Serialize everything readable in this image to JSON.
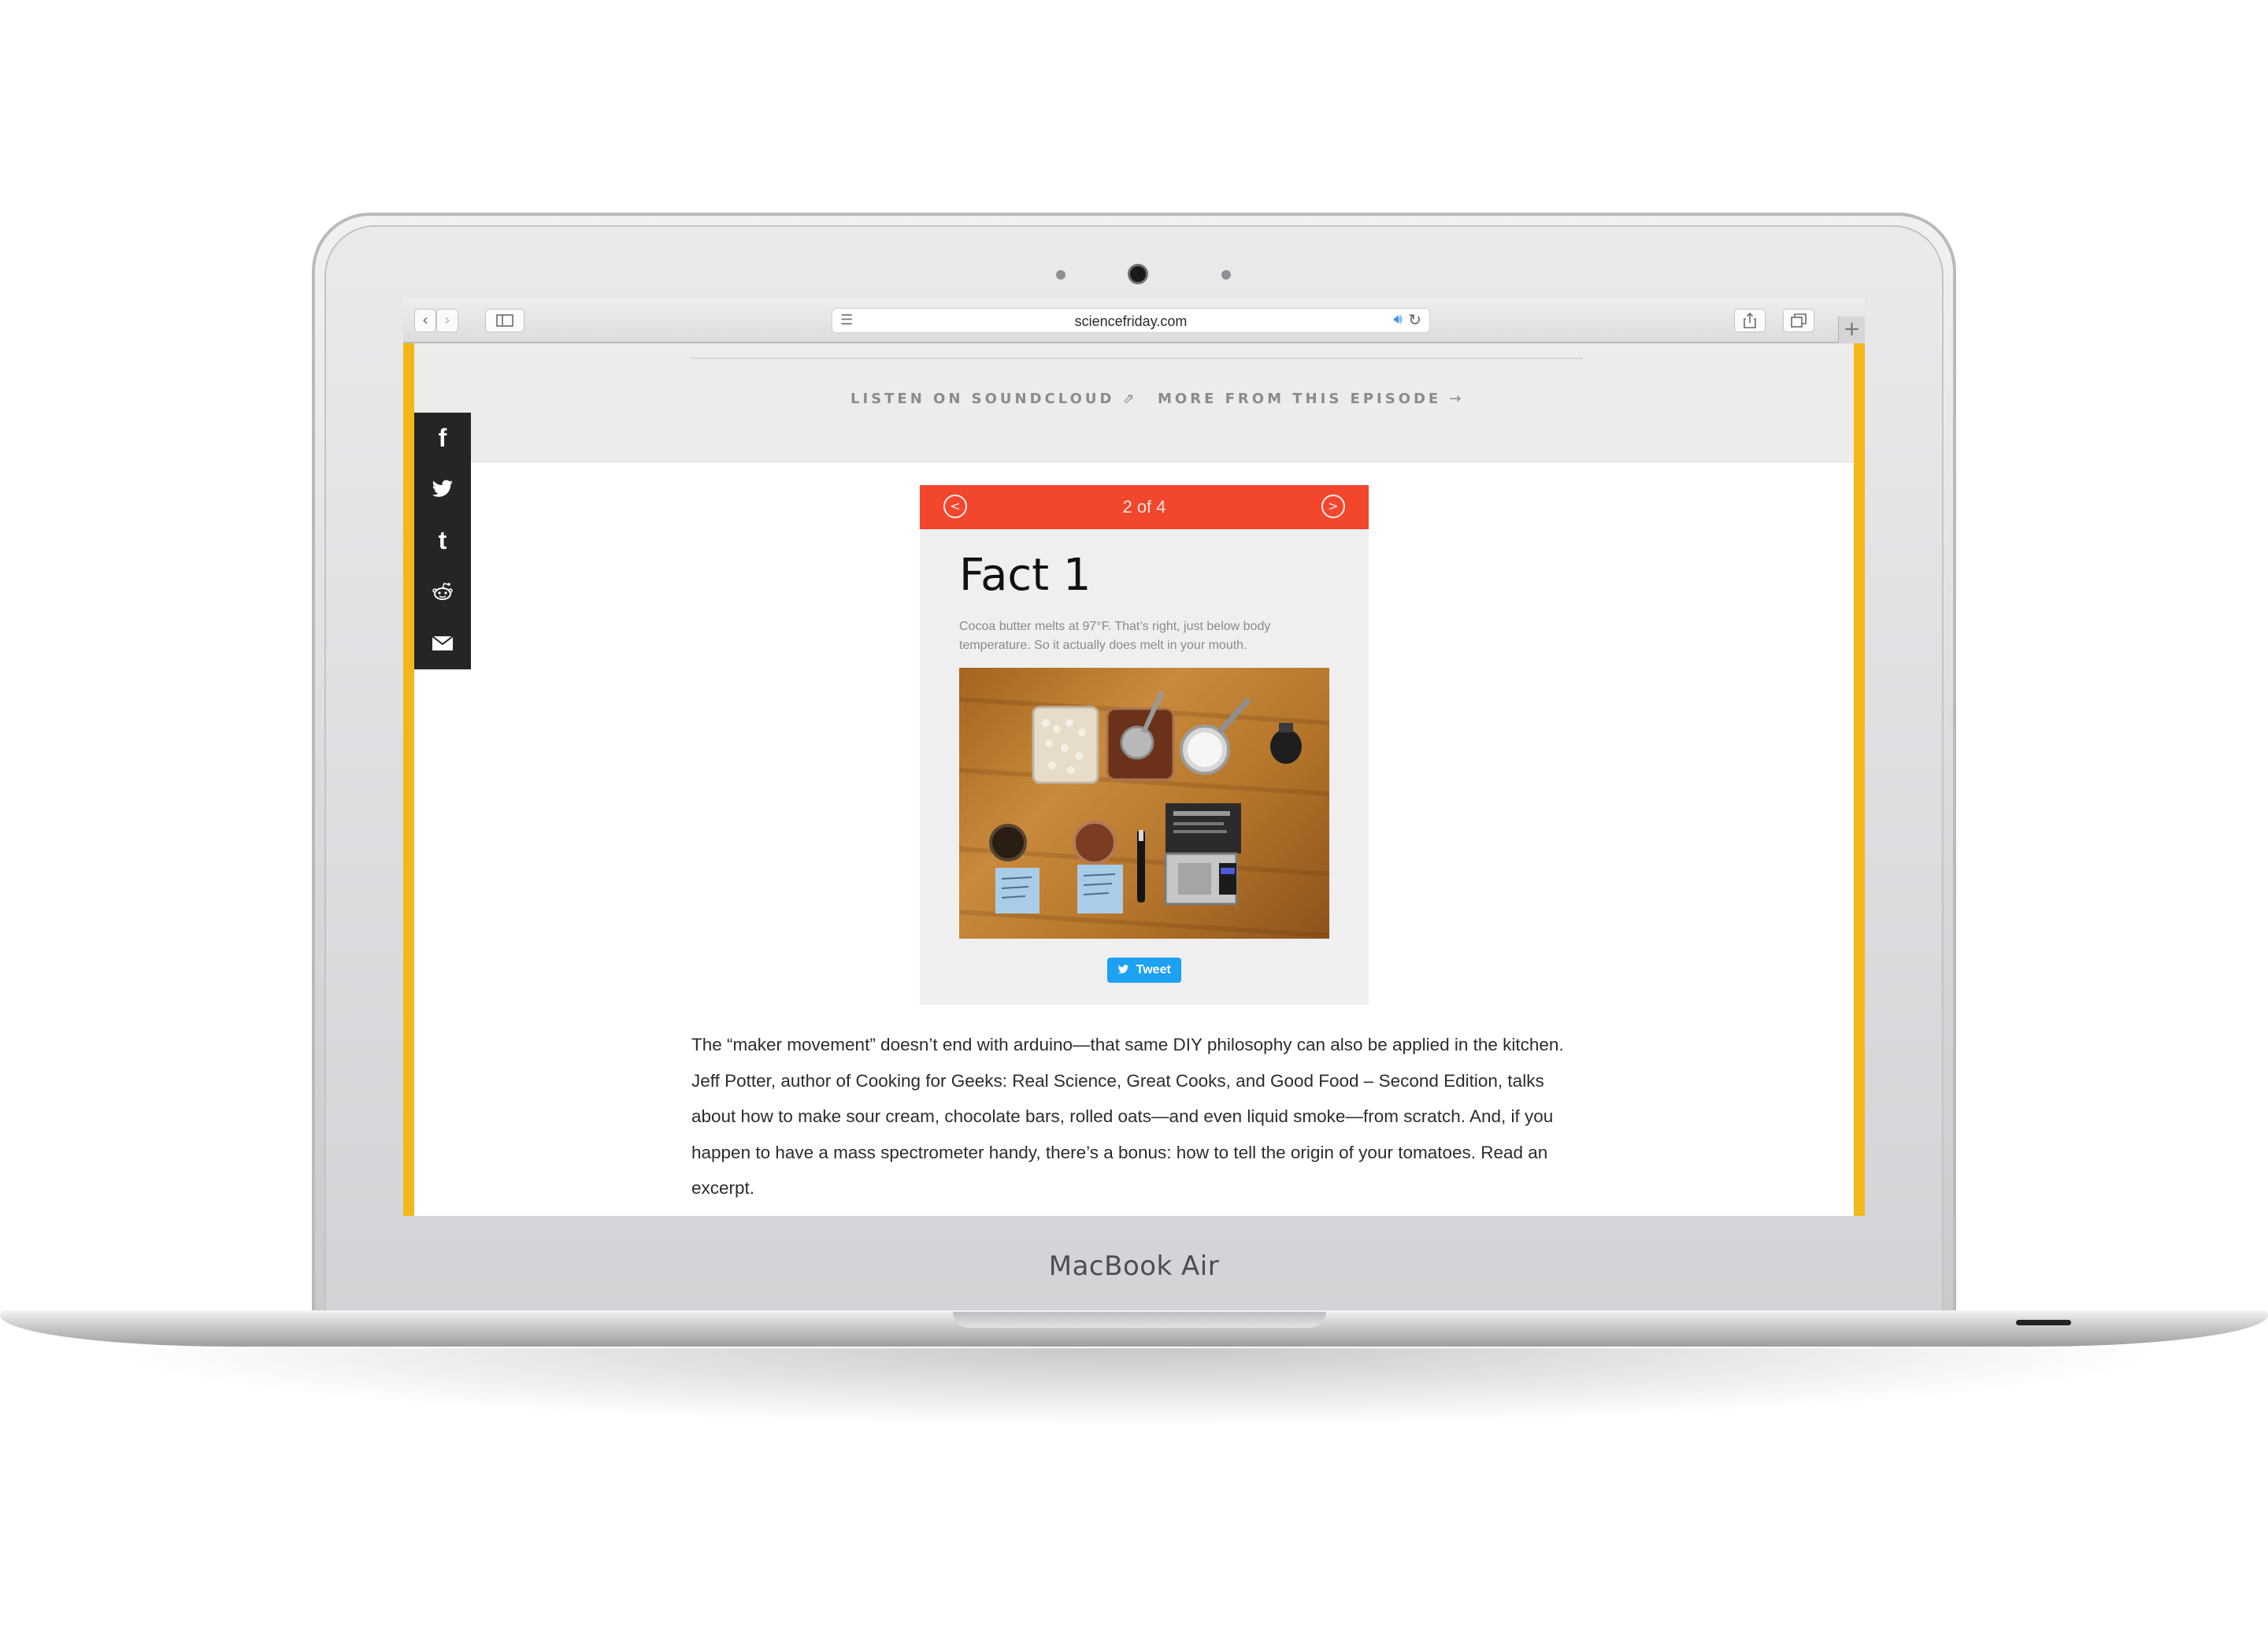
{
  "device": {
    "model_label": "MacBook Air"
  },
  "browser": {
    "back_icon": "chevron-left-icon",
    "forward_icon": "chevron-right-icon",
    "sidebar_icon": "sidebar-icon",
    "reader_icon": "reader-icon",
    "address": "sciencefriday.com",
    "audio_icon": "speaker-icon",
    "reload_icon": "reload-icon",
    "share_icon": "share-icon",
    "tabs_icon": "tabs-icon",
    "new_tab_icon": "plus-icon"
  },
  "episode_bar": {
    "listen_label": "LISTEN ON SOUNDCLOUD",
    "more_label": "MORE FROM THIS EPISODE"
  },
  "share_bar": {
    "items": [
      "facebook-icon",
      "twitter-icon",
      "tumblr-icon",
      "reddit-icon",
      "email-icon"
    ]
  },
  "slideshow": {
    "counter": "2 of 4",
    "title": "Fact 1",
    "body": "Cocoa butter melts at 97°F. That’s right, just below body temperature. So it actually does melt in your mouth.",
    "tweet_label": "Tweet"
  },
  "article": {
    "paragraph": "The “maker movement” doesn’t end with arduino—that same DIY philosophy can also be applied in the kitchen. Jeff Potter, author of Cooking for Geeks: Real Science, Great Cooks, and Good Food – Second Edition, talks about how to make sour cream, chocolate bars, rolled oats—and even liquid smoke—from scratch. And, if you happen to have a mass spectrometer handy, there’s a bonus: how to tell the origin of your tomatoes. Read an excerpt."
  },
  "colors": {
    "accent_yellow": "#f2b81b",
    "slide_header": "#f2462d",
    "tweet_blue": "#1da1f2",
    "share_bar": "#252525"
  }
}
